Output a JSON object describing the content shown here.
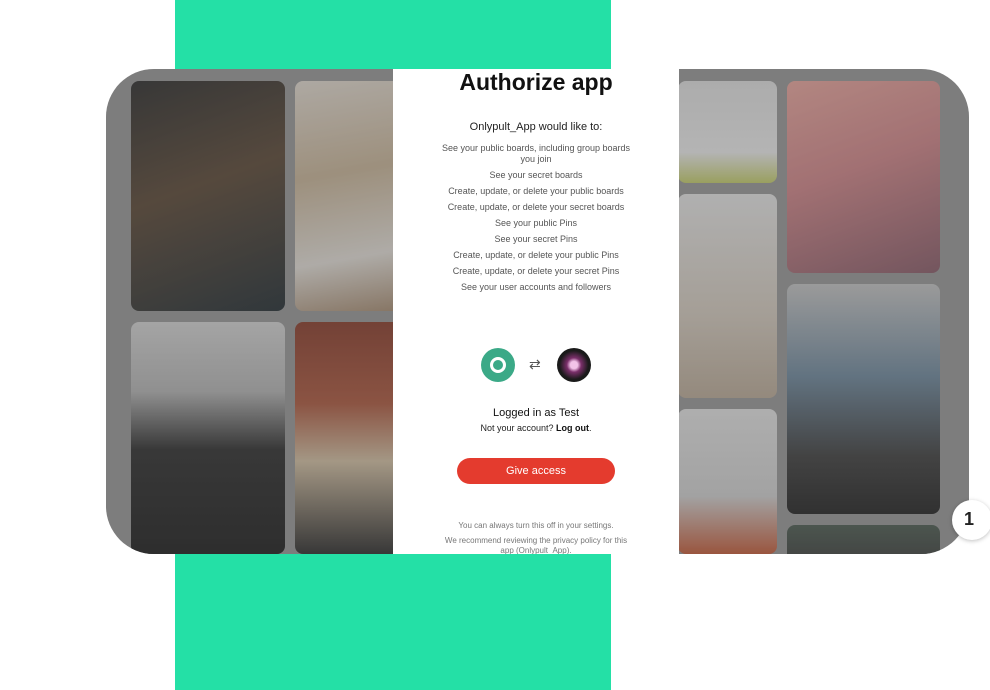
{
  "dialog": {
    "title": "Authorize app",
    "would_like": "Onlypult_App would like to:",
    "permissions": [
      "See your public boards, including group boards you join",
      "See your secret boards",
      "Create, update, or delete your public boards",
      "Create, update, or delete your secret boards",
      "See your public Pins",
      "See your secret Pins",
      "Create, update, or delete your public Pins",
      "Create, update, or delete your secret Pins",
      "See your user accounts and followers"
    ],
    "swap_icon": "⇄",
    "logged_in": "Logged in as Test",
    "not_account_prefix": "Not your account?",
    "logout_label": "Log out",
    "give_access_label": "Give access",
    "footer_note_1": "You can always turn this off in your settings.",
    "footer_note_2": "We recommend reviewing the privacy policy for this app (Onlypult_App)."
  },
  "chat": {
    "glyph": "1"
  },
  "colors": {
    "accent_green": "#24e0a6",
    "give_access_red": "#e43b2e",
    "app_logo_green": "#3ba987"
  },
  "icons": [
    "onlypult-logo-icon",
    "swap-arrows-icon",
    "pinterest-user-avatar-icon",
    "chat-bubble-icon"
  ]
}
